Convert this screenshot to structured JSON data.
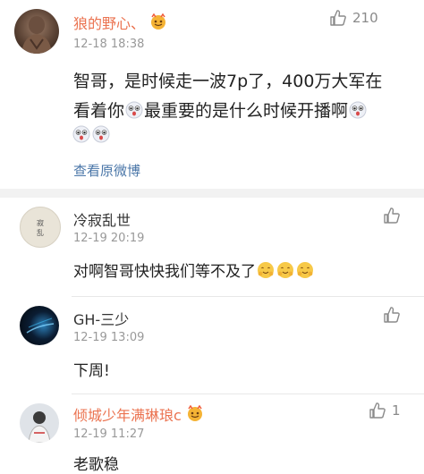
{
  "main_comment": {
    "username": "狼的野心、",
    "timestamp": "12-18 18:38",
    "likes": "210",
    "text_line1": "智哥，是时候走一波7p了，400万大军在",
    "text_line2_a": "看着你",
    "text_line2_b": "最重要的是什么时候开播啊",
    "view_original": "查看原微博"
  },
  "replies": [
    {
      "username": "冷寂乱世",
      "timestamp": "12-19 20:19",
      "text": "对啊智哥快快我们等不及了",
      "likes": ""
    },
    {
      "username": "GH-三少",
      "timestamp": "12-19 13:09",
      "text": "下周!",
      "likes": ""
    },
    {
      "username": "倾城少年满琳琅c",
      "timestamp": "12-19 11:27",
      "text": "老歌稳",
      "likes": "1"
    }
  ],
  "icons": {
    "like": "thumbs-up-icon",
    "emoji_hug": "hugging-face-emoji",
    "emoji_surprise": "surprised-face-emoji",
    "badge": "vip-crown-icon"
  },
  "colors": {
    "username_accent": "#eb7350",
    "link": "#4a76a8",
    "muted": "#999999"
  }
}
